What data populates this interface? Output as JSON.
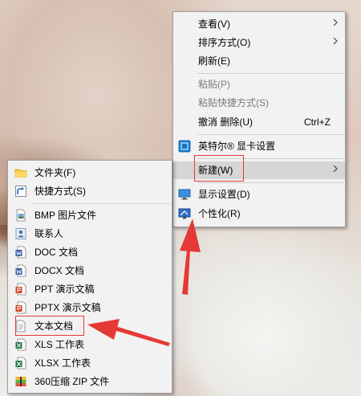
{
  "desktop_menu": {
    "items": [
      {
        "label": "查看(V)",
        "submenu": true
      },
      {
        "label": "排序方式(O)",
        "submenu": true
      },
      {
        "label": "刷新(E)"
      },
      {
        "label": "粘贴(P)",
        "disabled": true
      },
      {
        "label": "粘贴快捷方式(S)",
        "disabled": true
      },
      {
        "label": "撤消 删除(U)",
        "shortcut": "Ctrl+Z"
      },
      {
        "label": "英特尔® 显卡设置",
        "icon": "intel-graphics-icon"
      },
      {
        "label": "新建(W)",
        "submenu": true,
        "highlighted": true
      },
      {
        "label": "显示设置(D)",
        "icon": "display-settings-icon"
      },
      {
        "label": "个性化(R)",
        "icon": "personalize-icon"
      }
    ]
  },
  "new_submenu": {
    "items": [
      {
        "label": "文件夹(F)",
        "icon": "folder-icon"
      },
      {
        "label": "快捷方式(S)",
        "icon": "shortcut-icon"
      },
      {
        "label": "BMP 图片文件",
        "icon": "bmp-file-icon"
      },
      {
        "label": "联系人",
        "icon": "contact-icon"
      },
      {
        "label": "DOC 文档",
        "icon": "doc-file-icon"
      },
      {
        "label": "DOCX 文档",
        "icon": "docx-file-icon"
      },
      {
        "label": "PPT 演示文稿",
        "icon": "ppt-file-icon"
      },
      {
        "label": "PPTX 演示文稿",
        "icon": "pptx-file-icon"
      },
      {
        "label": "文本文档",
        "icon": "text-document-icon",
        "highlighted": true
      },
      {
        "label": "XLS 工作表",
        "icon": "xls-file-icon"
      },
      {
        "label": "XLSX 工作表",
        "icon": "xlsx-file-icon"
      },
      {
        "label": "360压缩 ZIP 文件",
        "icon": "zip-archive-icon"
      }
    ]
  },
  "colors": {
    "menu_background": "#f2f2f2",
    "annotation_red": "#e53935",
    "word_blue": "#2b579a",
    "ppt_orange": "#d24726",
    "excel_green": "#217346"
  }
}
